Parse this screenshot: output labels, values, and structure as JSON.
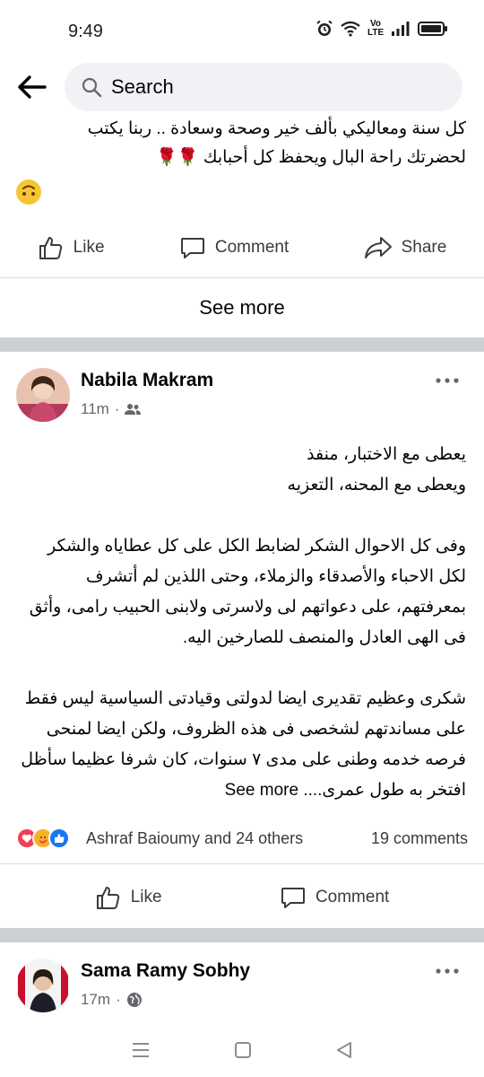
{
  "status_bar": {
    "time": "9:49",
    "volte_label": "Vo LTE"
  },
  "topbar": {
    "search_placeholder": "Search"
  },
  "prev_post": {
    "text_line1": "كل سنة ومعاليكي بألف خير وصحة وسعادة .. ربنا يكتب",
    "text_line2": "لحضرتك راحة البال ويحفظ كل أحبابك 🌹🌹",
    "actions": {
      "like": "Like",
      "comment": "Comment",
      "share": "Share"
    },
    "see_more": "See more"
  },
  "post": {
    "author": "Nabila Makram",
    "time": "11m",
    "paragraphs": [
      "يعطى مع الاختبار، منفذ\nويعطى مع المحنه، التعزيه",
      "وفى كل الاحوال الشكر لضابط الكل على كل عطاياه والشكر لكل الاحباء والأصدقاء والزملاء، وحتى اللذين لم أتشرف بمعرفتهم، على دعواتهم لى ولاسرتى ولابنى الحبيب رامى، وأثق فى الهى العادل والمنصف للصارخين اليه.",
      "شكرى وعظيم تقديرى ايضا لدولتى وقيادتى السياسية ليس فقط على مساندتهم لشخصى فى هذه الظروف، ولكن ايضا لمنحى فرصه خدمه وطنى على مدى ٧ سنوات، كان شرفا عظيما سأظل افتخر به طول عمرى...."
    ],
    "see_more": "See more",
    "reactors": "Ashraf Baioumy and 24 others",
    "comments": "19 comments",
    "actions": {
      "like": "Like",
      "comment": "Comment"
    }
  },
  "next_post": {
    "author": "Sama Ramy Sobhy",
    "time": "17m"
  },
  "colors": {
    "divider": "#dadde1",
    "gap": "#ccd0d5",
    "like_blue": "#1877f2",
    "love_red": "#f33e58",
    "care_yellow": "#f7b125"
  }
}
